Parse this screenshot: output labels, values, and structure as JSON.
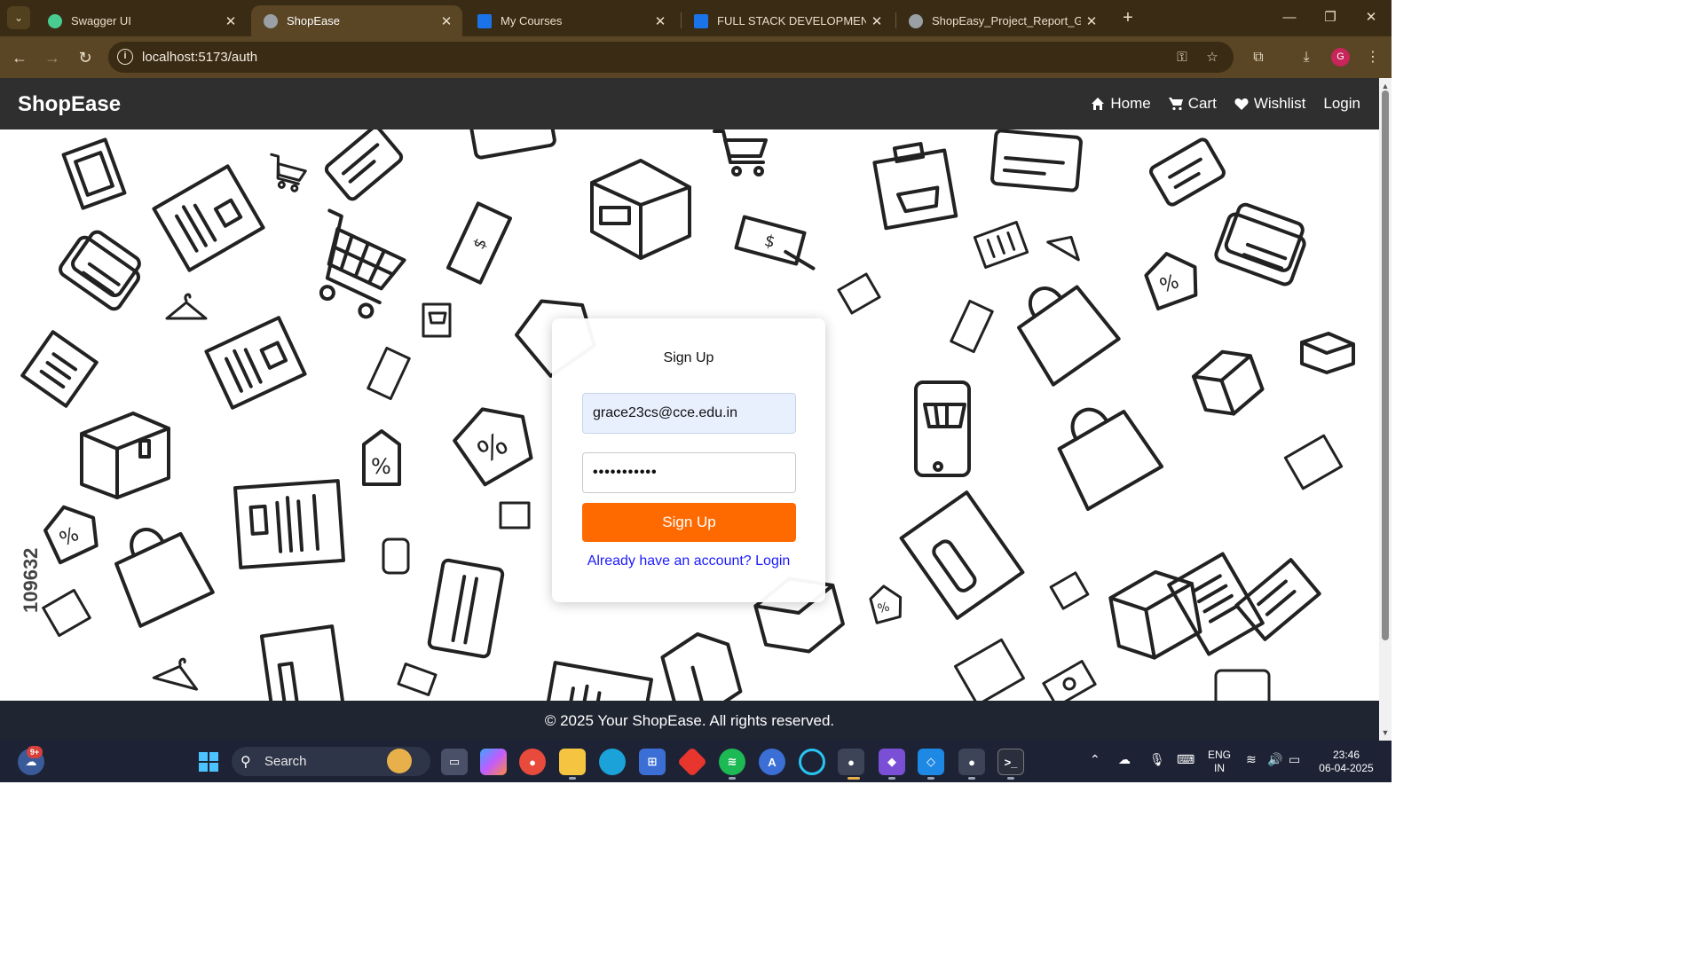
{
  "browser": {
    "tabs": [
      {
        "title": "Swagger UI",
        "icon": "swagger-icon",
        "color": "#49cc90"
      },
      {
        "title": "ShopEase",
        "icon": "globe-icon",
        "color": "#9aa0a6"
      },
      {
        "title": "My Courses",
        "icon": "courses-icon",
        "color": "#1a73e8"
      },
      {
        "title": "FULL STACK DEVELOPMENT - C",
        "icon": "courses-icon",
        "color": "#1a73e8"
      },
      {
        "title": "ShopEasy_Project_Report_GRAC",
        "icon": "globe-icon",
        "color": "#9aa0a6"
      }
    ],
    "active_tab_index": 1,
    "url": "localhost:5173/auth",
    "profile_initial": "G"
  },
  "app": {
    "brand": "ShopEase",
    "nav": [
      {
        "label": "Home",
        "icon": "home-icon"
      },
      {
        "label": "Cart",
        "icon": "cart-icon"
      },
      {
        "label": "Wishlist",
        "icon": "heart-icon"
      },
      {
        "label": "Login",
        "icon": ""
      }
    ],
    "background_watermark": "109632"
  },
  "auth": {
    "title": "Sign Up",
    "email_value": "grace23cs@cce.edu.in",
    "password_value": "•••••••••••",
    "submit_label": "Sign Up",
    "switch_link": "Already have an account? Login",
    "accent_color": "#ff6a00"
  },
  "footer": {
    "text": "© 2025 Your ShopEase. All rights reserved."
  },
  "taskbar": {
    "search_placeholder": "Search",
    "notification_badge": "9+",
    "language_line1": "ENG",
    "language_line2": "IN",
    "time": "23:46",
    "date": "06-04-2025"
  }
}
